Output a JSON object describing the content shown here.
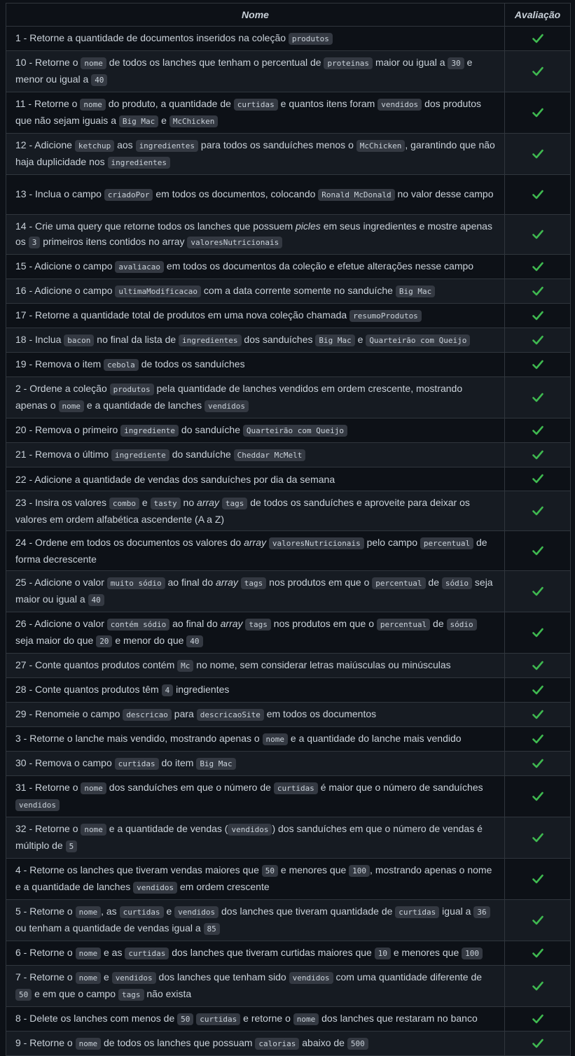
{
  "header": {
    "col_name": "Nome",
    "col_eval": "Avaliação"
  },
  "colors": {
    "check": "#3fb950",
    "code_bg": "#343942",
    "row_alt": "#161b22",
    "background": "#0d1117"
  },
  "check_icon": "check-mark-icon",
  "rows": [
    {
      "h": 1,
      "parts": [
        [
          "t",
          "1 - Retorne a quantidade de documentos inseridos na coleção "
        ],
        [
          "c",
          "produtos"
        ]
      ]
    },
    {
      "h": 2,
      "parts": [
        [
          "t",
          "10 - Retorne o "
        ],
        [
          "c",
          "nome"
        ],
        [
          "t",
          " de todos os lanches que tenham o percentual de "
        ],
        [
          "c",
          "proteinas"
        ],
        [
          "t",
          " maior ou igual a "
        ],
        [
          "c",
          "30"
        ],
        [
          "t",
          " e menor ou igual a "
        ],
        [
          "c",
          "40"
        ]
      ]
    },
    {
      "h": 2,
      "parts": [
        [
          "t",
          "11 - Retorne o "
        ],
        [
          "c",
          "nome"
        ],
        [
          "t",
          " do produto, a quantidade de "
        ],
        [
          "c",
          "curtidas"
        ],
        [
          "t",
          " e quantos itens foram "
        ],
        [
          "c",
          "vendidos"
        ],
        [
          "t",
          " dos produtos que não sejam iguais a "
        ],
        [
          "c",
          "Big Mac"
        ],
        [
          "t",
          " e "
        ],
        [
          "c",
          "McChicken"
        ]
      ]
    },
    {
      "h": 2,
      "parts": [
        [
          "t",
          "12 - Adicione "
        ],
        [
          "c",
          "ketchup"
        ],
        [
          "t",
          " aos "
        ],
        [
          "c",
          "ingredientes"
        ],
        [
          "t",
          " para todos os sanduíches menos o "
        ],
        [
          "c",
          "McChicken"
        ],
        [
          "t",
          ", garantindo que não haja duplicidade nos "
        ],
        [
          "c",
          "ingredientes"
        ]
      ]
    },
    {
      "h": 2,
      "parts": [
        [
          "t",
          "13 - Inclua o campo "
        ],
        [
          "c",
          "criadoPor"
        ],
        [
          "t",
          " em todos os documentos, colocando "
        ],
        [
          "c",
          "Ronald McDonald"
        ],
        [
          "t",
          " no valor desse campo"
        ]
      ]
    },
    {
      "h": 2,
      "parts": [
        [
          "t",
          "14 - Crie uma query que retorne todos os lanches que possuem "
        ],
        [
          "i",
          "picles"
        ],
        [
          "t",
          " em seus ingredientes e mostre apenas os "
        ],
        [
          "c",
          "3"
        ],
        [
          "t",
          " primeiros itens contidos no array "
        ],
        [
          "c",
          "valoresNutricionais"
        ]
      ]
    },
    {
      "h": 1,
      "parts": [
        [
          "t",
          "15 - Adicione o campo "
        ],
        [
          "c",
          "avaliacao"
        ],
        [
          "t",
          " em todos os documentos da coleção e efetue alterações nesse campo"
        ]
      ]
    },
    {
      "h": 1,
      "parts": [
        [
          "t",
          "16 - Adicione o campo "
        ],
        [
          "c",
          "ultimaModificacao"
        ],
        [
          "t",
          " com a data corrente somente no sanduíche "
        ],
        [
          "c",
          "Big Mac"
        ]
      ]
    },
    {
      "h": 1,
      "parts": [
        [
          "t",
          "17 - Retorne a quantidade total de produtos em uma nova coleção chamada "
        ],
        [
          "c",
          "resumoProdutos"
        ]
      ]
    },
    {
      "h": 1,
      "parts": [
        [
          "t",
          "18 - Inclua "
        ],
        [
          "c",
          "bacon"
        ],
        [
          "t",
          " no final da lista de "
        ],
        [
          "c",
          "ingredientes"
        ],
        [
          "t",
          " dos sanduíches "
        ],
        [
          "c",
          "Big Mac"
        ],
        [
          "t",
          " e "
        ],
        [
          "c",
          "Quarteirão com Queijo"
        ]
      ]
    },
    {
      "h": 1,
      "parts": [
        [
          "t",
          "19 - Remova o item "
        ],
        [
          "c",
          "cebola"
        ],
        [
          "t",
          " de todos os sanduíches"
        ]
      ]
    },
    {
      "h": 2,
      "parts": [
        [
          "t",
          "2 - Ordene a coleção "
        ],
        [
          "c",
          "produtos"
        ],
        [
          "t",
          " pela quantidade de lanches vendidos em ordem crescente, mostrando apenas o "
        ],
        [
          "c",
          "nome"
        ],
        [
          "t",
          " e a quantidade de lanches "
        ],
        [
          "c",
          "vendidos"
        ]
      ]
    },
    {
      "h": 1,
      "parts": [
        [
          "t",
          "20 - Remova o primeiro "
        ],
        [
          "c",
          "ingrediente"
        ],
        [
          "t",
          " do sanduíche "
        ],
        [
          "c",
          "Quarteirão com Queijo"
        ]
      ]
    },
    {
      "h": 1,
      "parts": [
        [
          "t",
          "21 - Remova o último "
        ],
        [
          "c",
          "ingrediente"
        ],
        [
          "t",
          " do sanduíche "
        ],
        [
          "c",
          "Cheddar McMelt"
        ]
      ]
    },
    {
      "h": 1,
      "parts": [
        [
          "t",
          "22 - Adicione a quantidade de vendas dos sanduíches por dia da semana"
        ]
      ]
    },
    {
      "h": 2,
      "parts": [
        [
          "t",
          "23 - Insira os valores "
        ],
        [
          "c",
          "combo"
        ],
        [
          "t",
          " e "
        ],
        [
          "c",
          "tasty"
        ],
        [
          "t",
          " no "
        ],
        [
          "i",
          "array"
        ],
        [
          "t",
          " "
        ],
        [
          "c",
          "tags"
        ],
        [
          "t",
          " de todos os sanduíches e aproveite para deixar os valores em ordem alfabética ascendente (A a Z)"
        ]
      ]
    },
    {
      "h": 2,
      "parts": [
        [
          "t",
          "24 - Ordene em todos os documentos os valores do "
        ],
        [
          "i",
          "array"
        ],
        [
          "t",
          " "
        ],
        [
          "c",
          "valoresNutricionais"
        ],
        [
          "t",
          " pelo campo "
        ],
        [
          "c",
          "percentual"
        ],
        [
          "t",
          " de forma decrescente"
        ]
      ]
    },
    {
      "h": 2,
      "parts": [
        [
          "t",
          "25 - Adicione o valor "
        ],
        [
          "c",
          "muito sódio"
        ],
        [
          "t",
          " ao final do "
        ],
        [
          "i",
          "array"
        ],
        [
          "t",
          " "
        ],
        [
          "c",
          "tags"
        ],
        [
          "t",
          " nos produtos em que o "
        ],
        [
          "c",
          "percentual"
        ],
        [
          "t",
          " de "
        ],
        [
          "c",
          "sódio"
        ],
        [
          "t",
          " seja maior ou igual a "
        ],
        [
          "c",
          "40"
        ]
      ]
    },
    {
      "h": 2,
      "parts": [
        [
          "t",
          "26 - Adicione o valor "
        ],
        [
          "c",
          "contém sódio"
        ],
        [
          "t",
          " ao final do "
        ],
        [
          "i",
          "array"
        ],
        [
          "t",
          " "
        ],
        [
          "c",
          "tags"
        ],
        [
          "t",
          " nos produtos em que o "
        ],
        [
          "c",
          "percentual"
        ],
        [
          "t",
          " de "
        ],
        [
          "c",
          "sódio"
        ],
        [
          "t",
          " seja maior do que "
        ],
        [
          "c",
          "20"
        ],
        [
          "t",
          " e menor do que "
        ],
        [
          "c",
          "40"
        ]
      ]
    },
    {
      "h": 1,
      "parts": [
        [
          "t",
          "27 - Conte quantos produtos contém "
        ],
        [
          "c",
          "Mc"
        ],
        [
          "t",
          " no nome, sem considerar letras maiúsculas ou minúsculas"
        ]
      ]
    },
    {
      "h": 1,
      "parts": [
        [
          "t",
          "28 - Conte quantos produtos têm "
        ],
        [
          "c",
          "4"
        ],
        [
          "t",
          " ingredientes"
        ]
      ]
    },
    {
      "h": 1,
      "parts": [
        [
          "t",
          "29 - Renomeie o campo "
        ],
        [
          "c",
          "descricao"
        ],
        [
          "t",
          " para "
        ],
        [
          "c",
          "descricaoSite"
        ],
        [
          "t",
          " em todos os documentos"
        ]
      ]
    },
    {
      "h": 1,
      "parts": [
        [
          "t",
          "3 - Retorne o lanche mais vendido, mostrando apenas o "
        ],
        [
          "c",
          "nome"
        ],
        [
          "t",
          " e a quantidade do lanche mais vendido"
        ]
      ]
    },
    {
      "h": 1,
      "parts": [
        [
          "t",
          "30 - Remova o campo "
        ],
        [
          "c",
          "curtidas"
        ],
        [
          "t",
          " do item "
        ],
        [
          "c",
          "Big Mac"
        ]
      ]
    },
    {
      "h": 2,
      "parts": [
        [
          "t",
          "31 - Retorne o "
        ],
        [
          "c",
          "nome"
        ],
        [
          "t",
          " dos sanduíches em que o número de "
        ],
        [
          "c",
          "curtidas"
        ],
        [
          "t",
          " é maior que o número de sanduíches "
        ],
        [
          "c",
          "vendidos"
        ]
      ]
    },
    {
      "h": 2,
      "parts": [
        [
          "t",
          "32 - Retorne o "
        ],
        [
          "c",
          "nome"
        ],
        [
          "t",
          " e a quantidade de vendas ("
        ],
        [
          "c",
          "vendidos"
        ],
        [
          "t",
          ") dos sanduíches em que o número de vendas é múltiplo de "
        ],
        [
          "c",
          "5"
        ]
      ]
    },
    {
      "h": 2,
      "parts": [
        [
          "t",
          "4 - Retorne os lanches que tiveram vendas maiores que "
        ],
        [
          "c",
          "50"
        ],
        [
          "t",
          " e menores que "
        ],
        [
          "c",
          "100"
        ],
        [
          "t",
          ", mostrando apenas o nome e a quantidade de lanches "
        ],
        [
          "c",
          "vendidos"
        ],
        [
          "t",
          " em ordem crescente"
        ]
      ]
    },
    {
      "h": 2,
      "parts": [
        [
          "t",
          "5 - Retorne o "
        ],
        [
          "c",
          "nome"
        ],
        [
          "t",
          ", as "
        ],
        [
          "c",
          "curtidas"
        ],
        [
          "t",
          " e "
        ],
        [
          "c",
          "vendidos"
        ],
        [
          "t",
          " dos lanches que tiveram quantidade de "
        ],
        [
          "c",
          "curtidas"
        ],
        [
          "t",
          " igual a "
        ],
        [
          "c",
          "36"
        ],
        [
          "t",
          " ou tenham a quantidade de vendas igual a "
        ],
        [
          "c",
          "85"
        ]
      ]
    },
    {
      "h": 1,
      "parts": [
        [
          "t",
          "6 - Retorne o "
        ],
        [
          "c",
          "nome"
        ],
        [
          "t",
          " e as "
        ],
        [
          "c",
          "curtidas"
        ],
        [
          "t",
          " dos lanches que tiveram curtidas maiores que "
        ],
        [
          "c",
          "10"
        ],
        [
          "t",
          " e menores que "
        ],
        [
          "c",
          "100"
        ]
      ]
    },
    {
      "h": 2,
      "parts": [
        [
          "t",
          "7 - Retorne o "
        ],
        [
          "c",
          "nome"
        ],
        [
          "t",
          " e "
        ],
        [
          "c",
          "vendidos"
        ],
        [
          "t",
          " dos lanches que tenham sido "
        ],
        [
          "c",
          "vendidos"
        ],
        [
          "t",
          " com uma quantidade diferente de "
        ],
        [
          "c",
          "50"
        ],
        [
          "t",
          " e em que o campo "
        ],
        [
          "c",
          "tags"
        ],
        [
          "t",
          " não exista"
        ]
      ]
    },
    {
      "h": 1,
      "parts": [
        [
          "t",
          "8 - Delete os lanches com menos de "
        ],
        [
          "c",
          "50"
        ],
        [
          "t",
          " "
        ],
        [
          "c",
          "curtidas"
        ],
        [
          "t",
          " e retorne o "
        ],
        [
          "c",
          "nome"
        ],
        [
          "t",
          " dos lanches que restaram no banco"
        ]
      ]
    },
    {
      "h": 1,
      "parts": [
        [
          "t",
          "9 - Retorne o "
        ],
        [
          "c",
          "nome"
        ],
        [
          "t",
          " de todos os lanches que possuam "
        ],
        [
          "c",
          "calorias"
        ],
        [
          "t",
          " abaixo de "
        ],
        [
          "c",
          "500"
        ]
      ]
    }
  ]
}
